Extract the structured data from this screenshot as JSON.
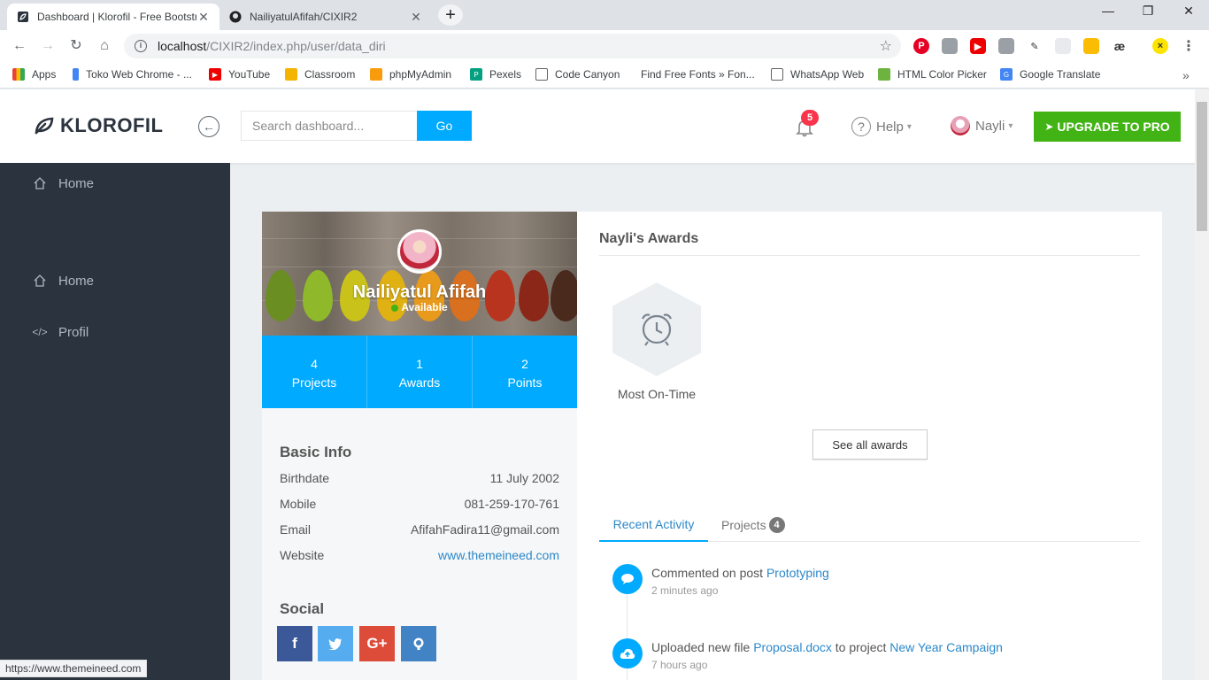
{
  "browser": {
    "tabs": [
      {
        "title": "Dashboard | Klorofil - Free Bootstr",
        "close": "✕"
      },
      {
        "title": "NailiyatulAfifah/CIXIR2",
        "close": "✕"
      }
    ],
    "url_host": "localhost",
    "url_path": "/CIXIR2/index.php/user/data_diri",
    "bookmarks": [
      "Apps",
      "Toko Web Chrome - ...",
      "YouTube",
      "Classroom",
      "phpMyAdmin",
      "Pexels",
      "Code Canyon",
      "Find Free Fonts » Fon...",
      "WhatsApp Web",
      "HTML Color Picker",
      "Google Translate"
    ],
    "status_url": "https://www.themeineed.com"
  },
  "app": {
    "logo": "KLOROFIL",
    "search_placeholder": "Search dashboard...",
    "go_label": "Go",
    "notifications_count": "5",
    "help_label": "Help",
    "user_name": "Nayli",
    "upgrade_label": "UPGRADE TO PRO"
  },
  "sidebar": {
    "partial_item": "Home",
    "items": [
      {
        "label": "Home",
        "icon": "home-icon"
      },
      {
        "label": "Profil",
        "icon": "code-icon"
      }
    ]
  },
  "profile": {
    "name": "Nailiyatul Afifah",
    "status": "Available",
    "stats": [
      {
        "value": "4",
        "label": "Projects"
      },
      {
        "value": "1",
        "label": "Awards"
      },
      {
        "value": "2",
        "label": "Points"
      }
    ],
    "basic_info_title": "Basic Info",
    "basic_info": [
      {
        "label": "Birthdate",
        "value": "11 July 2002"
      },
      {
        "label": "Mobile",
        "value": "081-259-170-761"
      },
      {
        "label": "Email",
        "value": "AfifahFadira11@gmail.com"
      },
      {
        "label": "Website",
        "value": "www.themeineed.com"
      }
    ],
    "social_title": "Social",
    "social": [
      {
        "name": "facebook",
        "glyph": "f",
        "color": "#3b5998"
      },
      {
        "name": "twitter",
        "glyph": "t",
        "color": "#55acee"
      },
      {
        "name": "google-plus",
        "glyph": "G+",
        "color": "#dd4b39"
      },
      {
        "name": "github",
        "glyph": "gh",
        "color": "#4183c4"
      }
    ]
  },
  "awards": {
    "title": "Nayli's Awards",
    "items": [
      {
        "label": "Most On-Time",
        "icon": "alarm-clock-icon"
      }
    ],
    "see_all": "See all awards"
  },
  "activity": {
    "tabs": [
      {
        "label": "Recent Activity"
      },
      {
        "label": "Projects",
        "count": "4"
      }
    ],
    "items": [
      {
        "prefix": "Commented on post ",
        "link": "Prototyping",
        "time": "2 minutes ago",
        "icon": "comment-icon"
      },
      {
        "prefix": "Uploaded new file ",
        "link": "Proposal.docx",
        "mid": " to project ",
        "link2": "New Year Campaign",
        "time": "7 hours ago",
        "icon": "cloud-upload-icon"
      }
    ]
  },
  "colors": {
    "accent": "#00aaff",
    "sidebar": "#2b333e",
    "upgrade": "#41b314",
    "badge": "#f9354c",
    "link": "#2c88c9"
  }
}
